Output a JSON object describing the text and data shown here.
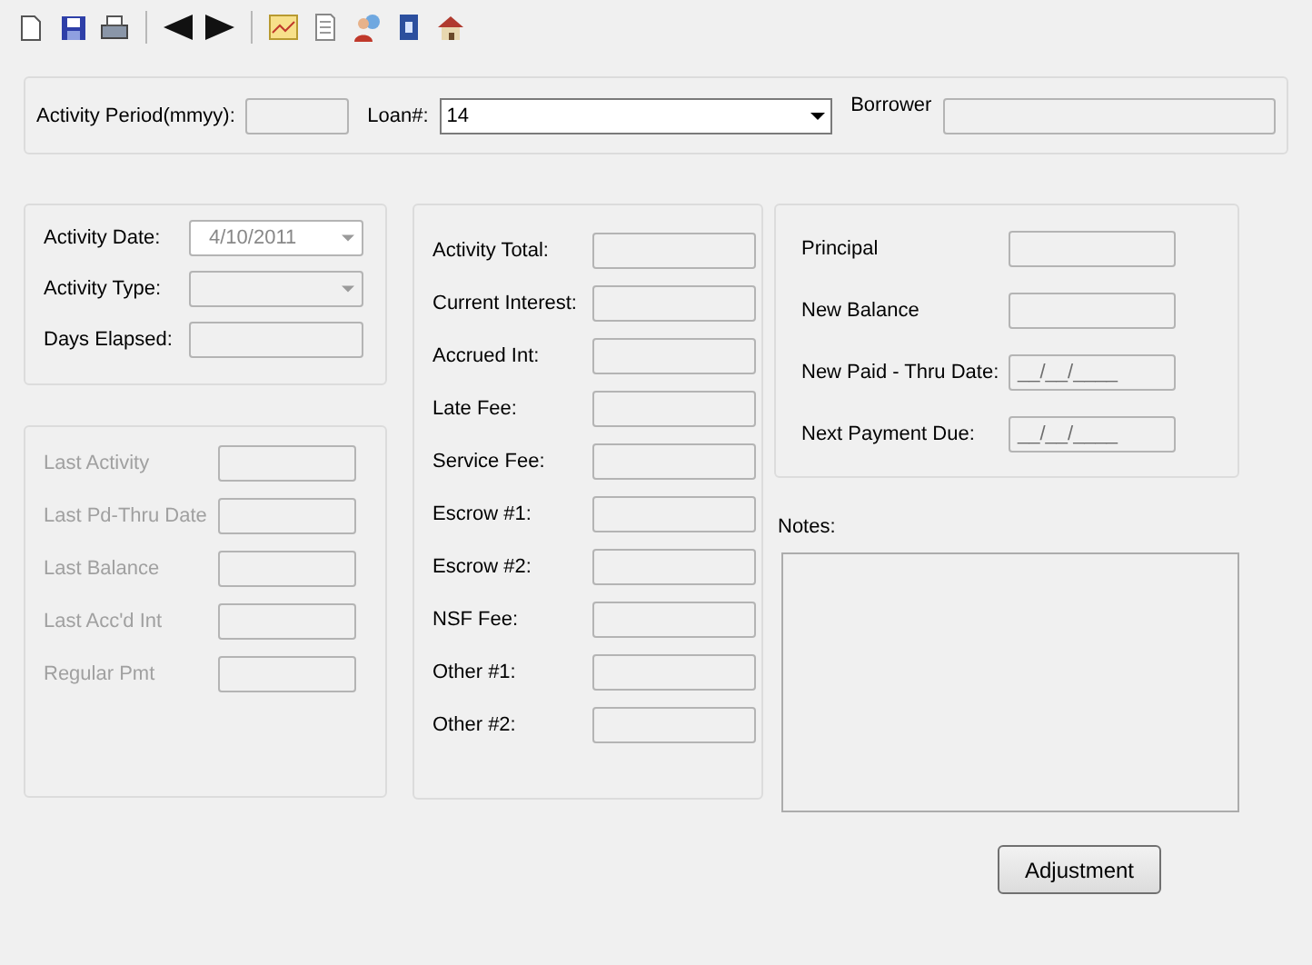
{
  "toolbar": [
    {
      "kind": "new"
    },
    {
      "kind": "save"
    },
    {
      "kind": "print"
    },
    {
      "kind": "separator"
    },
    {
      "kind": "back"
    },
    {
      "kind": "forward"
    },
    {
      "kind": "separator"
    },
    {
      "kind": "chart"
    },
    {
      "kind": "document"
    },
    {
      "kind": "people"
    },
    {
      "kind": "help"
    },
    {
      "kind": "house"
    }
  ],
  "header": {
    "period_label": "Activity Period(mmyy):",
    "loan_label": "Loan#:",
    "loan_value": "14",
    "borrower_label": "Borrower"
  },
  "activity": [
    {
      "kind": "date",
      "label": "Activity Date:",
      "value": "4/10/2011"
    },
    {
      "kind": "select",
      "label": "Activity Type:"
    },
    {
      "kind": "text",
      "label": "Days Elapsed:"
    }
  ],
  "previous": {
    "disabled": true,
    "rows": [
      "Last Activity",
      "Last Pd-Thru Date",
      "Last Balance",
      "Last Acc'd Int",
      "Regular Pmt"
    ]
  },
  "amounts": [
    "Activity Total:",
    "Current Interest:",
    "Accrued Int:",
    "Late Fee:",
    "Service Fee:",
    "Escrow #1:",
    "Escrow #2:",
    "NSF Fee:",
    "Other #1:",
    "Other #2:"
  ],
  "balances": [
    {
      "label": "Principal"
    },
    {
      "label": "New Balance"
    },
    {
      "label": "New Paid - Thru Date:",
      "value": "__/__/____"
    },
    {
      "label": "Next Payment Due:",
      "value": "__/__/____"
    }
  ],
  "notes_label": "Notes:",
  "button": "Adjustment"
}
